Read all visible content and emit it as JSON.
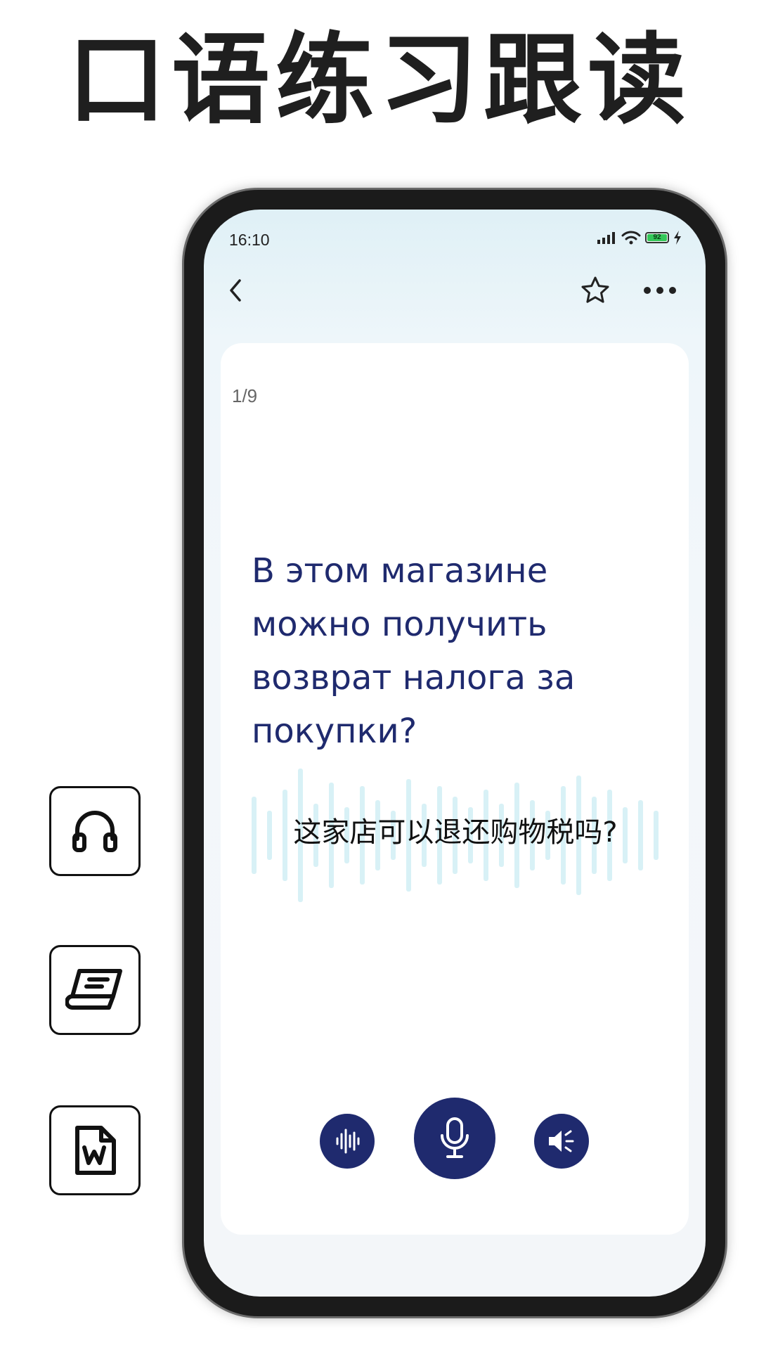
{
  "headline": "口语练习跟读",
  "side_icons": [
    "headphones-icon",
    "book-icon",
    "word-document-icon"
  ],
  "status_bar": {
    "time": "16:10",
    "battery_level": "92",
    "battery_percent": 92,
    "colors": {
      "battery": "#34c759"
    }
  },
  "nav": {
    "back_icon": "chevron-left-icon",
    "favorite_icon": "star-outline-icon",
    "more_icon": "more-horizontal-icon"
  },
  "card": {
    "counter": "1/9",
    "sentence": "В этом магазине можно получить возврат налога за покупки?",
    "translation": "这家店可以退还购物税吗?"
  },
  "controls": {
    "left_icon": "waveform-icon",
    "center_icon": "microphone-icon",
    "right_icon": "speaker-icon"
  },
  "colors": {
    "accent": "#1f2a6e",
    "text_dark": "#111111",
    "waveform": "#d8f1f6"
  }
}
